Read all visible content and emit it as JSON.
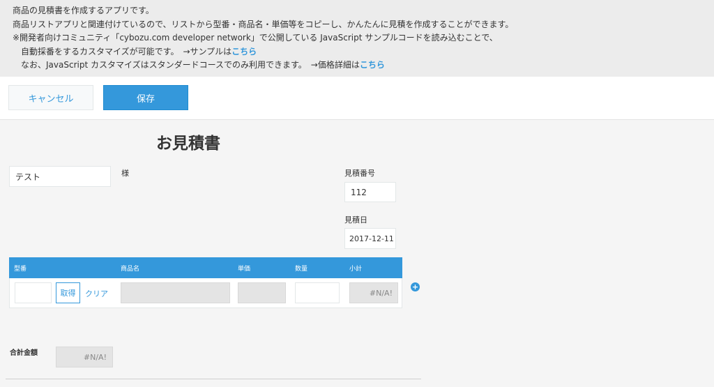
{
  "description": {
    "line1": "商品の見積書を作成するアプリです。",
    "line2": "商品リストアプリと関連付けているので、リストから型番・商品名・単価等をコピーし、かんたんに見積を作成することができます。",
    "line3": "※開発者向けコミュニティ「cybozu.com developer network」で公開している JavaScript サンプルコードを読み込むことで、",
    "line4_text": "自動採番をするカスタマイズが可能です。　→サンプルは",
    "line4_link": "こちら",
    "line5_text": "なお、JavaScript カスタマイズはスタンダードコースでのみ利用できます。　→価格詳細は",
    "line5_link": "こちら",
    "link_color": "#3498db"
  },
  "toolbar": {
    "cancel_label": "キャンセル",
    "save_label": "保存",
    "accent": "#3498db"
  },
  "form": {
    "title": "お見積書",
    "customer_value": "テスト",
    "customer_suffix": "様",
    "quote_number_label": "見積番号",
    "quote_number_value": "112",
    "quote_date_label": "見積日",
    "quote_date_value": "2017-12-11"
  },
  "table": {
    "headers": [
      "型番",
      "商品名",
      "単価",
      "数量",
      "小計"
    ],
    "get_button": "取得",
    "clear_link": "クリア",
    "subtotal_value": "#N/A!",
    "add_row_icon": "+"
  },
  "total": {
    "label": "合計金額",
    "value": "#N/A!"
  }
}
